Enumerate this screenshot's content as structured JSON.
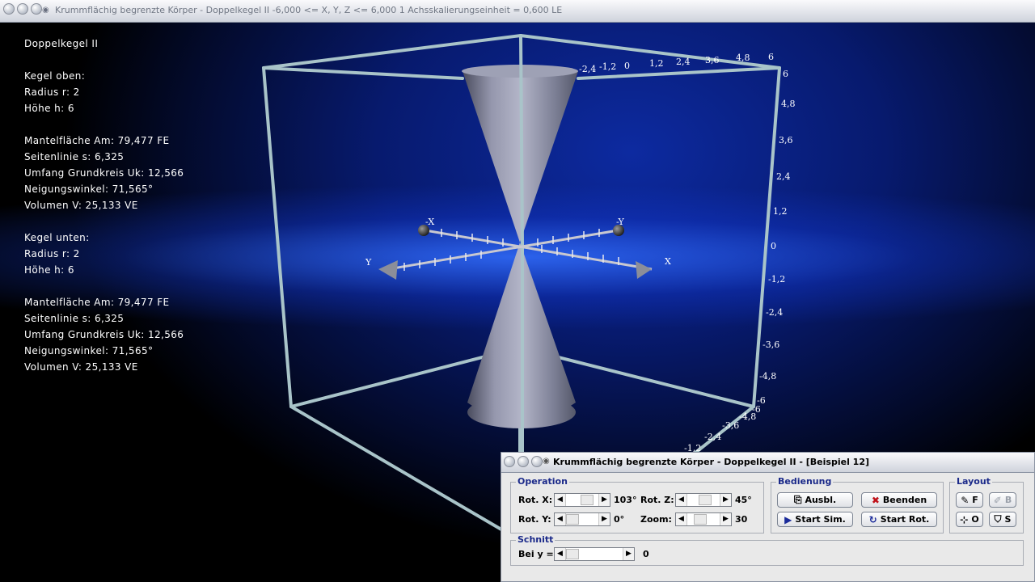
{
  "window": {
    "title": "Krummflächig begrenzte Körper - Doppelkegel II   -6,000 <= X, Y, Z <= 6,000    1 Achsskalierungseinheit = 0,600 LE"
  },
  "info": {
    "heading": "Doppelkegel II",
    "upper_title": "Kegel oben:",
    "upper_radius": "Radius r: 2",
    "upper_height": "Höhe h: 6",
    "upper_mantel": "Mantelfläche Am: 79,477 FE",
    "upper_seite": "Seitenlinie s: 6,325",
    "upper_umfang": "Umfang Grundkreis Uk: 12,566",
    "upper_neigung": "Neigungswinkel: 71,565°",
    "upper_volumen": "Volumen V: 25,133 VE",
    "lower_title": "Kegel unten:",
    "lower_radius": "Radius r: 2",
    "lower_height": "Höhe h: 6",
    "lower_mantel": "Mantelfläche Am: 79,477 FE",
    "lower_seite": "Seitenlinie s: 6,325",
    "lower_umfang": "Umfang Grundkreis Uk: 12,566",
    "lower_neigung": "Neigungswinkel: 71,565°",
    "lower_volumen": "Volumen V: 25,133 VE"
  },
  "axes": {
    "labels": {
      "x_pos": "X",
      "x_neg": "-X",
      "y_pos": "Y",
      "y_neg": "-Y"
    },
    "top_ticks": [
      "-2,4",
      "-1,2",
      "0",
      "1,2",
      "2,4",
      "3,6",
      "4,8",
      "6"
    ],
    "right_ticks": [
      "6",
      "4,8",
      "3,6",
      "2,4",
      "1,2",
      "0",
      "-1,2",
      "-2,4",
      "-3,6",
      "-4,8",
      "-6"
    ],
    "bottom_ticks": [
      "-6",
      "-4,8",
      "-3,6",
      "-2,4",
      "-1,2"
    ]
  },
  "panel": {
    "title": "Krummflächig begrenzte Körper - Doppelkegel II - [Beispiel 12]",
    "operation": {
      "legend": "Operation",
      "rot_x_label": "Rot. X:",
      "rot_x_value": "103°",
      "rot_y_label": "Rot. Y:",
      "rot_y_value": "0°",
      "rot_z_label": "Rot. Z:",
      "rot_z_value": "45°",
      "zoom_label": "Zoom:",
      "zoom_value": "30"
    },
    "bedienung": {
      "legend": "Bedienung",
      "ausbl": "Ausbl.",
      "beenden": "Beenden",
      "start_sim": "Start Sim.",
      "start_rot": "Start Rot."
    },
    "layout": {
      "legend": "Layout",
      "f": "F",
      "b": "B",
      "o": "O",
      "s": "S"
    },
    "schnitt": {
      "legend": "Schnitt",
      "label": "Bei y =",
      "value": "0"
    }
  },
  "colors": {
    "frame": "#a9c4c9",
    "cone": "#8b8fa6",
    "legend_text": "#1b2a8a"
  }
}
